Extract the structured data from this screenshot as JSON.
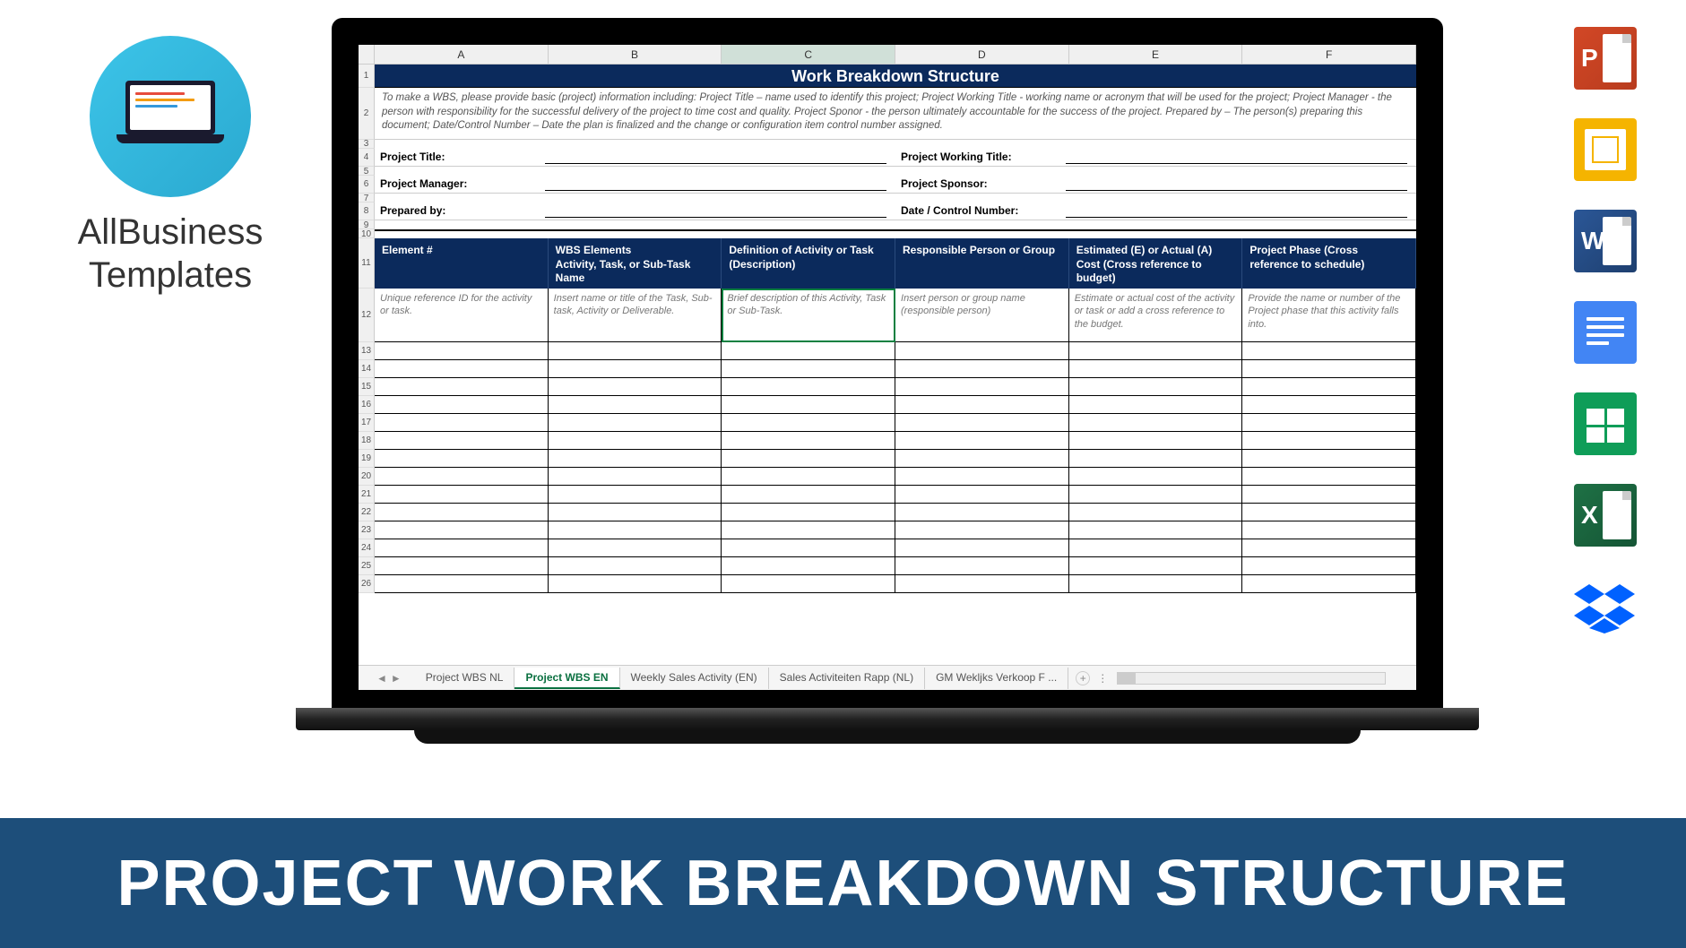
{
  "logo": {
    "line1": "AllBusiness",
    "line2": "Templates"
  },
  "banner": "PROJECT WORK BREAKDOWN STRUCTURE",
  "columns": [
    "A",
    "B",
    "C",
    "D",
    "E",
    "F"
  ],
  "selected_column": "C",
  "row_numbers": [
    1,
    2,
    3,
    4,
    5,
    6,
    7,
    8,
    9,
    10,
    11,
    12,
    13,
    14,
    15,
    16,
    17,
    18,
    19,
    20,
    21,
    22,
    23,
    24,
    25,
    26
  ],
  "sheet": {
    "title": "Work Breakdown Structure",
    "description": "To make a WBS, please provide basic (project) information including: Project Title – name used to identify this project; Project Working Title - working name or acronym that will be used for the project; Project Manager - the person with responsibility for the successful delivery of the project to time cost and quality. Project Sponor - the person ultimately accountable for the success of the project. Prepared by – The person(s) preparing this document; Date/Control Number – Date the plan is finalized and the change or configuration item control number assigned.",
    "info": {
      "project_title": "Project Title:",
      "project_working_title": "Project Working Title:",
      "project_manager": "Project Manager:",
      "project_sponsor": "Project Sponsor:",
      "prepared_by": "Prepared by:",
      "date_control": "Date / Control Number:"
    },
    "table_headers": {
      "element": "Element #",
      "wbs_line1": "WBS Elements",
      "wbs_line2": "Activity, Task, or Sub-Task Name",
      "definition": "Definition of Activity or Task (Description)",
      "responsible": "Responsible Person or Group",
      "estimated": "Estimated (E) or Actual (A) Cost (Cross reference to budget)",
      "phase": "Project Phase (Cross reference to schedule)"
    },
    "hints": {
      "element": "Unique reference ID for the activity or task.",
      "wbs": "Insert name or title of the Task, Sub-task, Activity or Deliverable.",
      "definition": "Brief description of this Activity, Task or Sub-Task.",
      "responsible": "Insert person or group name (responsible person)",
      "estimated": "Estimate or actual cost of the activity or task or add a cross reference to the budget.",
      "phase": "Provide the name or number of the Project phase that this activity falls into."
    }
  },
  "tabs": {
    "list": [
      "Project WBS NL",
      "Project WBS EN",
      "Weekly Sales Activity (EN)",
      "Sales Activiteiten Rapp (NL)",
      "GM Wekljks Verkoop F ..."
    ],
    "active": "Project WBS EN"
  },
  "right_icons": [
    "PowerPoint",
    "Google Slides",
    "Word",
    "Google Docs",
    "Google Sheets",
    "Excel",
    "Dropbox"
  ]
}
